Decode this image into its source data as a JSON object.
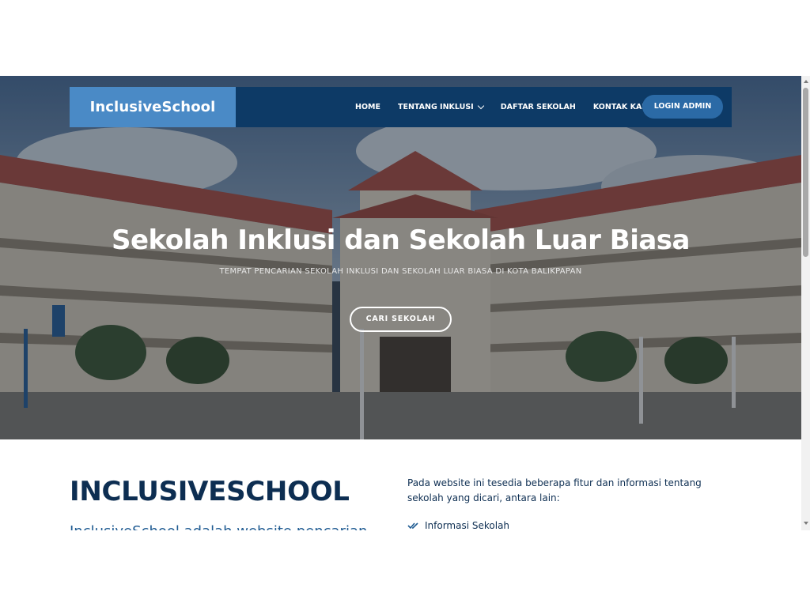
{
  "navbar": {
    "brand": "InclusiveSchool",
    "items": [
      {
        "label": "HOME"
      },
      {
        "label": "TENTANG INKLUSI",
        "dropdown": true
      },
      {
        "label": "DAFTAR SEKOLAH"
      },
      {
        "label": "KONTAK KAMI"
      }
    ],
    "login_label": "LOGIN ADMIN"
  },
  "hero": {
    "title": "Sekolah Inklusi dan Sekolah Luar Biasa",
    "subtitle": "TEMPAT PENCARIAN SEKOLAH INKLUSI DAN SEKOLAH LUAR BIASA DI KOTA BALIKPAPAN",
    "cta_label": "CARI SEKOLAH"
  },
  "about": {
    "title": "INCLUSIVESCHOOL",
    "lead": "InclusiveSchool adalah website pencarian",
    "description": "Pada website ini tesedia beberapa fitur dan informasi tentang sekolah yang dicari, antara lain:",
    "features": [
      {
        "label": "Informasi Sekolah",
        "icon": "double-check-icon"
      }
    ]
  },
  "colors": {
    "navbar_bg": "#0d3a66",
    "brand_bg": "#4a8ac6",
    "login_bg": "#2b6aa6",
    "heading": "#0d2e52",
    "accent": "#1f5b92"
  }
}
